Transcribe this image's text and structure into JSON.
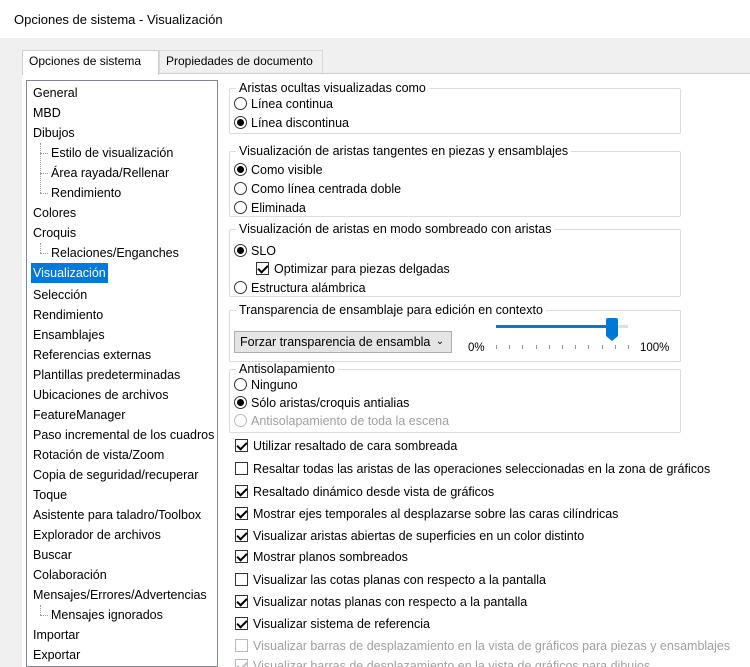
{
  "window": {
    "title": "Opciones de sistema - Visualización"
  },
  "tabs": [
    {
      "label": "Opciones de sistema",
      "active": true
    },
    {
      "label": "Propiedades de documento",
      "active": false
    }
  ],
  "tree": {
    "items": [
      {
        "label": "General",
        "level": 0
      },
      {
        "label": "MBD",
        "level": 0
      },
      {
        "label": "Dibujos",
        "level": 0
      },
      {
        "label": "Estilo de visualización",
        "level": 1
      },
      {
        "label": "Área rayada/Rellenar",
        "level": 1
      },
      {
        "label": "Rendimiento",
        "level": 1
      },
      {
        "label": "Colores",
        "level": 0
      },
      {
        "label": "Croquis",
        "level": 0
      },
      {
        "label": "Relaciones/Enganches",
        "level": 1
      },
      {
        "label": "Visualización",
        "level": 0,
        "selected": true
      },
      {
        "label": "Selección",
        "level": 0
      },
      {
        "label": "Rendimiento",
        "level": 0
      },
      {
        "label": "Ensamblajes",
        "level": 0
      },
      {
        "label": "Referencias externas",
        "level": 0
      },
      {
        "label": "Plantillas predeterminadas",
        "level": 0
      },
      {
        "label": "Ubicaciones de archivos",
        "level": 0
      },
      {
        "label": "FeatureManager",
        "level": 0
      },
      {
        "label": "Paso incremental de los cuadros",
        "level": 0
      },
      {
        "label": "Rotación de vista/Zoom",
        "level": 0
      },
      {
        "label": "Copia de seguridad/recuperar",
        "level": 0
      },
      {
        "label": "Toque",
        "level": 0
      },
      {
        "label": "Asistente para taladro/Toolbox",
        "level": 0
      },
      {
        "label": "Explorador de archivos",
        "level": 0
      },
      {
        "label": "Buscar",
        "level": 0
      },
      {
        "label": "Colaboración",
        "level": 0
      },
      {
        "label": "Mensajes/Errores/Advertencias",
        "level": 0
      },
      {
        "label": "Mensajes ignorados",
        "level": 1
      },
      {
        "label": "Importar",
        "level": 0
      },
      {
        "label": "Exportar",
        "level": 0
      }
    ]
  },
  "groups": {
    "hidden_edges": {
      "title": "Aristas ocultas visualizadas como",
      "options": [
        "Línea continua",
        "Línea discontinua"
      ],
      "selected": 1
    },
    "tangent_edges": {
      "title": "Visualización de aristas tangentes en piezas y ensamblajes",
      "options": [
        "Como visible",
        "Como línea centrada doble",
        "Eliminada"
      ],
      "selected": 0
    },
    "shaded_edges": {
      "title": "Visualización de aristas en modo sombreado con aristas",
      "options": [
        "SLO",
        "Estructura alámbrica"
      ],
      "selected": 0,
      "sub_checkbox": "Optimizar para piezas delgadas",
      "sub_checked": true
    },
    "transparency": {
      "title": "Transparencia de ensamblaje para edición en contexto",
      "dropdown_value": "Forzar transparencia de ensambla",
      "slider_min_label": "0%",
      "slider_max_label": "100%",
      "slider_value_percent": 88
    },
    "antialias": {
      "title": "Antisolapamiento",
      "options": [
        "Ninguno",
        "Sólo aristas/croquis antialias",
        "Antisolapamiento de toda la escena"
      ],
      "selected": 1,
      "disabled": [
        2
      ]
    }
  },
  "checkboxes": [
    {
      "label": "Utilizar resaltado de cara sombreada",
      "checked": true,
      "disabled": false
    },
    {
      "label": "Resaltar todas las aristas de las operaciones seleccionadas en la zona de gráficos",
      "checked": false,
      "disabled": false
    },
    {
      "label": "Resaltado dinámico desde vista de gráficos",
      "checked": true,
      "disabled": false
    },
    {
      "label": "Mostrar ejes temporales al desplazarse sobre las caras cilíndricas",
      "checked": true,
      "disabled": false
    },
    {
      "label": "Visualizar aristas abiertas de superficies en un color distinto",
      "checked": true,
      "disabled": false
    },
    {
      "label": "Mostrar planos sombreados",
      "checked": true,
      "disabled": false
    },
    {
      "label": "Visualizar las cotas planas con respecto a la pantalla",
      "checked": false,
      "disabled": false
    },
    {
      "label": "Visualizar notas planas con respecto a la pantalla",
      "checked": true,
      "disabled": false
    },
    {
      "label": "Visualizar sistema de referencia",
      "checked": true,
      "disabled": false
    },
    {
      "label": "Visualizar barras de desplazamiento en la vista de gráficos para piezas y ensamblajes",
      "checked": false,
      "disabled": true
    },
    {
      "label": "Visualizar barras de desplazamiento en la vista de gráficos para dibujos",
      "checked": true,
      "disabled": true
    }
  ],
  "colors": {
    "accent": "#0078d7",
    "selected_text": "#ffffff",
    "disabled_text": "#a0a0a0"
  }
}
